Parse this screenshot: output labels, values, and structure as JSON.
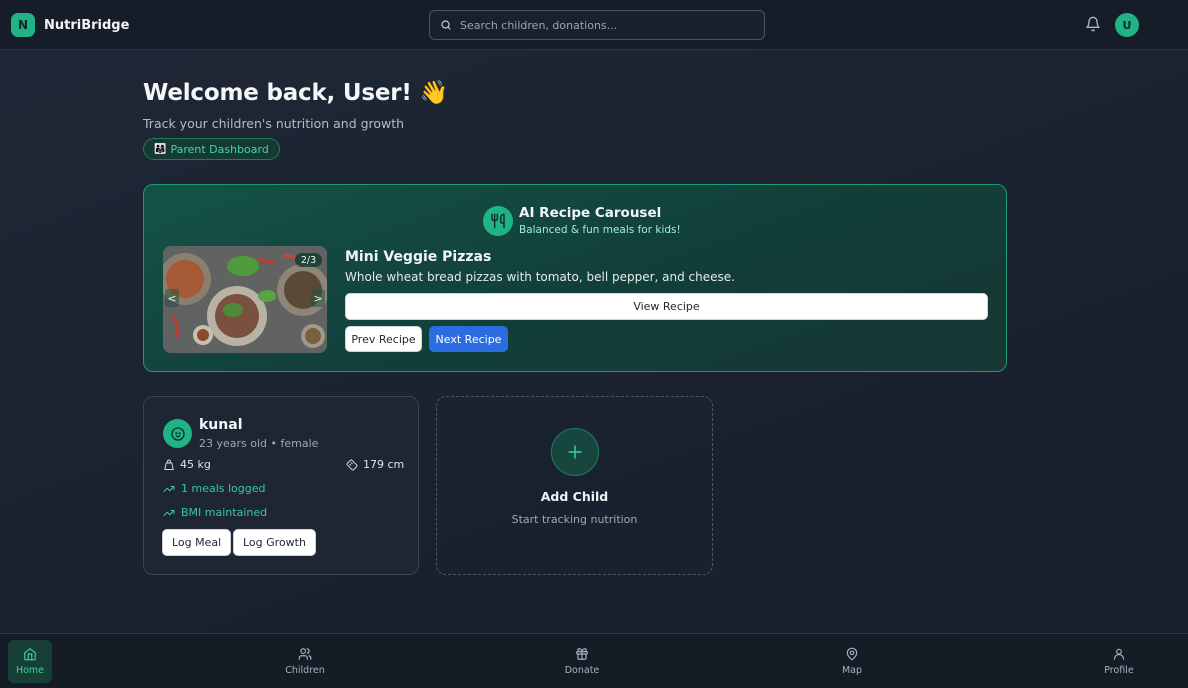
{
  "header": {
    "brand_initial": "N",
    "brand_name": "NutriBridge",
    "search_placeholder": "Search children, donations...",
    "user_initial": "U"
  },
  "welcome": {
    "title": "Welcome back, User! 👋",
    "subtitle": "Track your children's nutrition and growth",
    "role_badge": "Parent Dashboard",
    "role_icon": "👨‍👩‍👧"
  },
  "recipe_carousel": {
    "title": "AI Recipe Carousel",
    "subtitle": "Balanced & fun meals for kids!",
    "counter": "2/3",
    "recipe_name": "Mini Veggie Pizzas",
    "recipe_description": "Whole wheat bread pizzas with tomato, bell pepper, and cheese.",
    "view_label": "View Recipe",
    "prev_label": "Prev Recipe",
    "next_label": "Next Recipe",
    "prev_arrow": "<",
    "next_arrow": ">"
  },
  "child": {
    "name": "kunal",
    "meta": "23 years old • female",
    "weight": "45 kg",
    "height": "179 cm",
    "meals": "1 meals logged",
    "bmi": "BMI maintained",
    "log_meal_label": "Log Meal",
    "log_growth_label": "Log Growth"
  },
  "add_child": {
    "title": "Add Child",
    "subtitle": "Start tracking nutrition"
  },
  "bottom_nav": {
    "items": [
      {
        "label": "Home",
        "icon": "home-icon",
        "active": true
      },
      {
        "label": "Children",
        "icon": "users-icon"
      },
      {
        "label": "Donate",
        "icon": "gift-icon"
      },
      {
        "label": "Map",
        "icon": "map-pin-icon"
      },
      {
        "label": "Profile",
        "icon": "user-icon"
      }
    ]
  },
  "colors": {
    "accent": "#1fb486",
    "primary_button": "#2b6de0",
    "background": "#1d2532"
  }
}
